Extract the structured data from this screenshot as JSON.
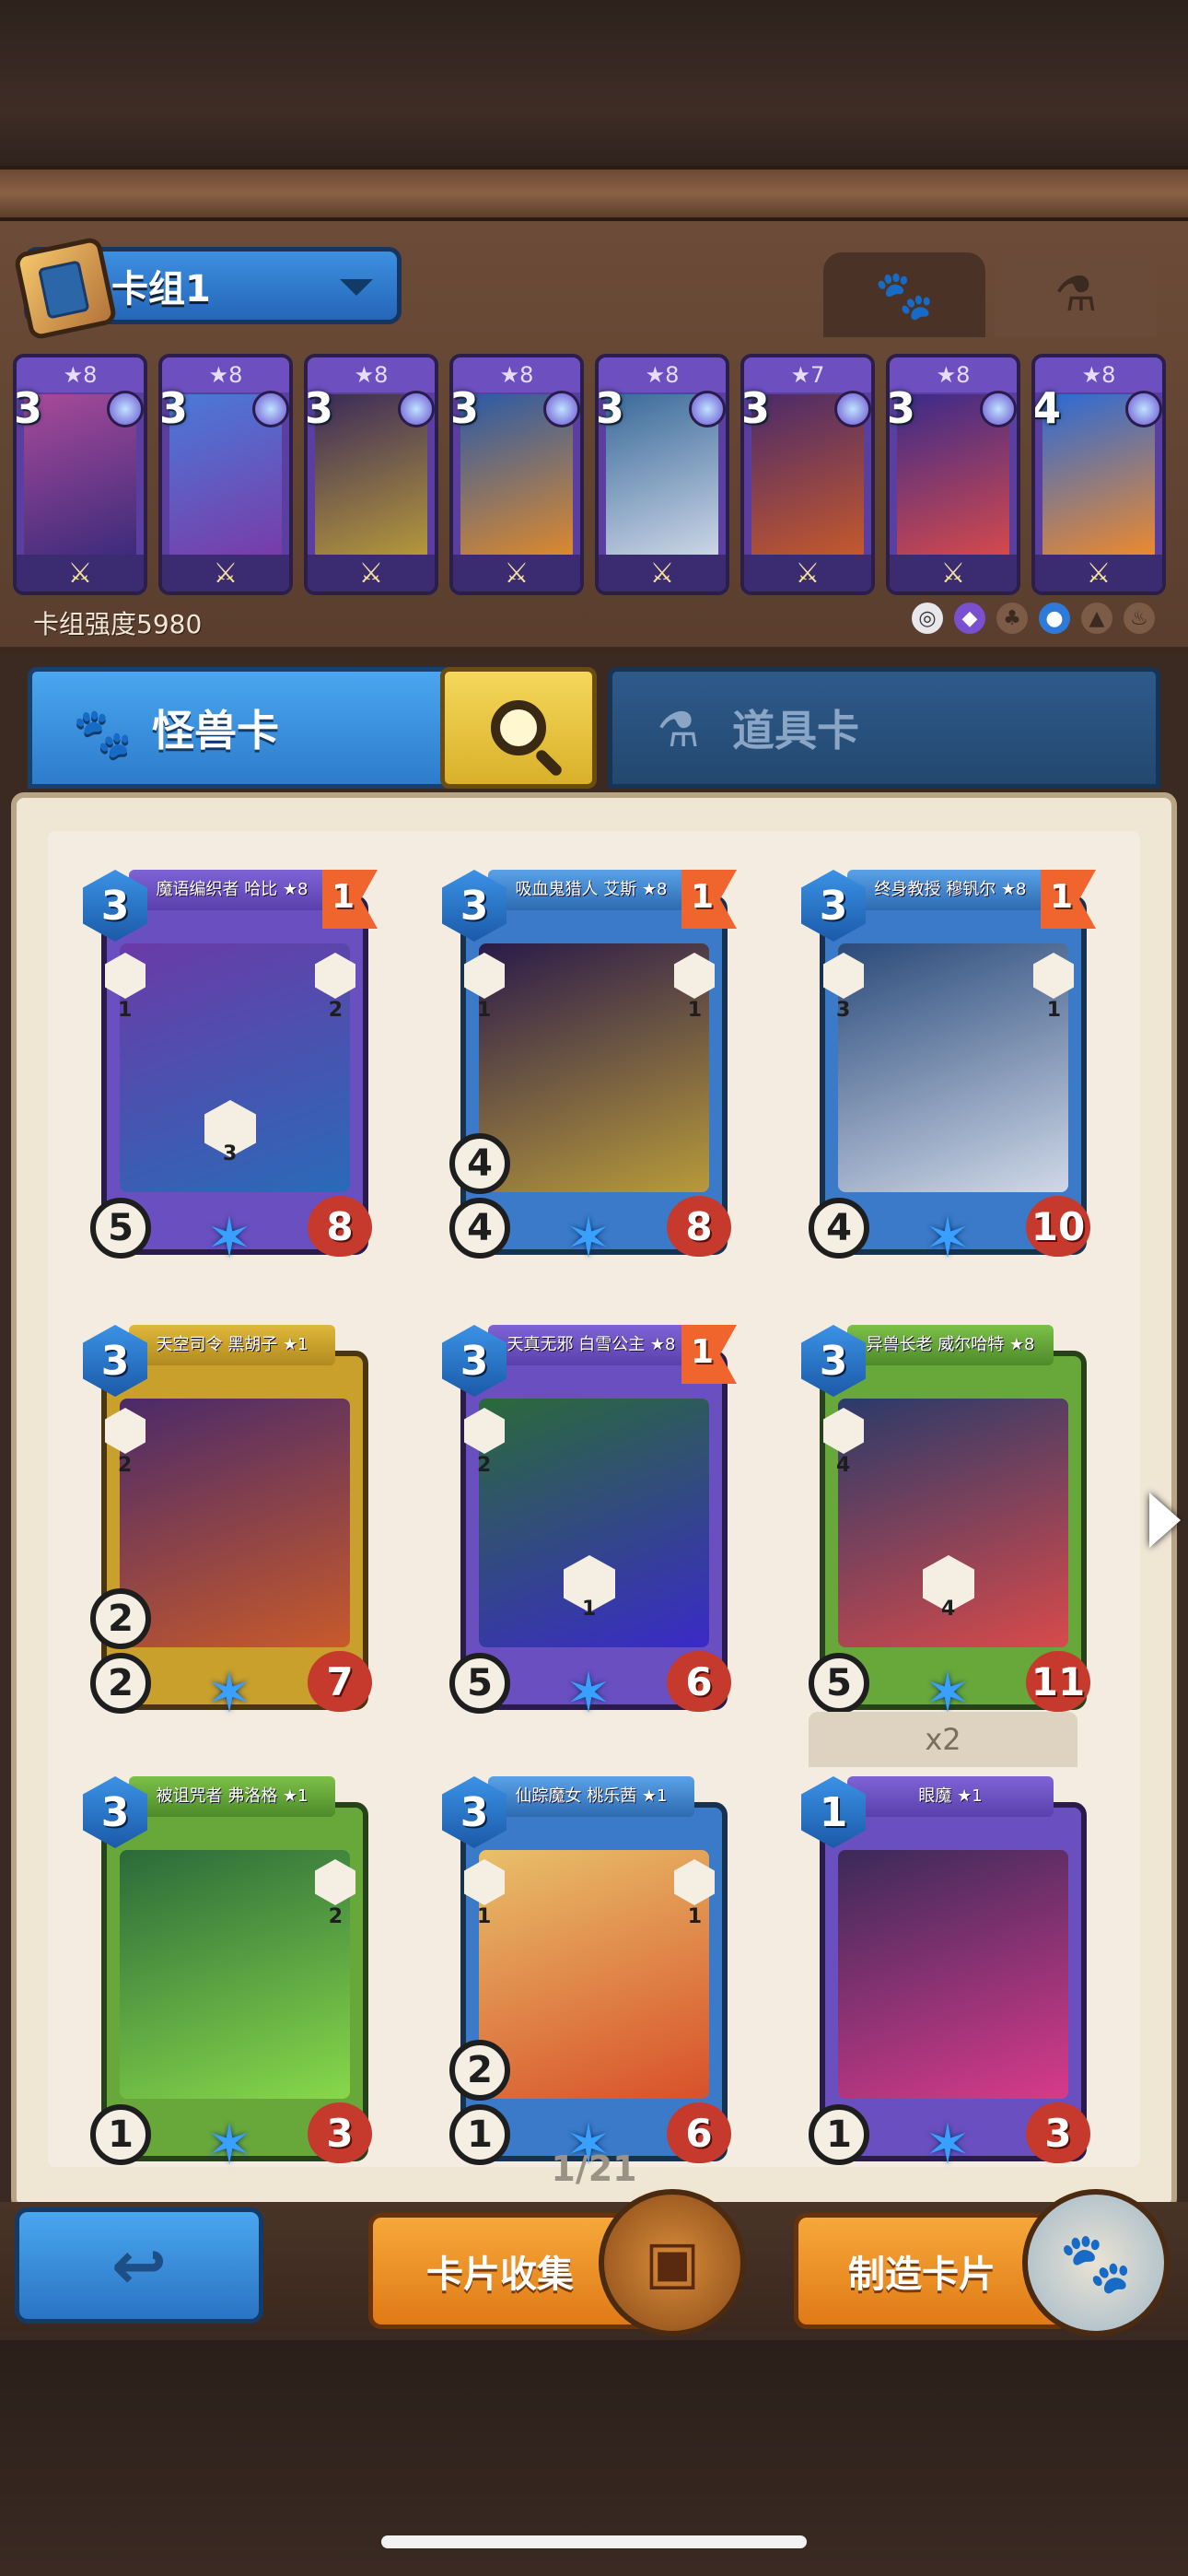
{
  "deck": {
    "name": "卡组1",
    "strength_label": "卡组强度5980",
    "cards": [
      {
        "cost": "3",
        "stars": "★8",
        "art_colors": [
          "#a84a9a",
          "#3a2a7a"
        ],
        "type_icon": "sword"
      },
      {
        "cost": "3",
        "stars": "★8",
        "art_colors": [
          "#4a7ad8",
          "#7a3aa8"
        ],
        "type_icon": "staff"
      },
      {
        "cost": "3",
        "stars": "★8",
        "art_colors": [
          "#3a2a5a",
          "#b89a3a"
        ],
        "type_icon": "sword-staff"
      },
      {
        "cost": "3",
        "stars": "★8",
        "art_colors": [
          "#2a5aa8",
          "#e08a2a"
        ],
        "type_icon": "staff"
      },
      {
        "cost": "3",
        "stars": "★8",
        "art_colors": [
          "#3a6a9a",
          "#cfd8e8"
        ],
        "type_icon": "staff"
      },
      {
        "cost": "3",
        "stars": "★7",
        "art_colors": [
          "#4a2a6a",
          "#c85a2a"
        ],
        "type_icon": "dice-staff"
      },
      {
        "cost": "3",
        "stars": "★8",
        "art_colors": [
          "#3a2a8a",
          "#d84a4a"
        ],
        "type_icon": "dice"
      },
      {
        "cost": "4",
        "stars": "★8",
        "art_colors": [
          "#2a6ad8",
          "#f08a2a"
        ],
        "type_icon": "sword"
      }
    ]
  },
  "tabs": {
    "monster": "怪兽卡",
    "item": "道具卡"
  },
  "collection": [
    {
      "title": "魔语编织者 哈比 ★8",
      "cost": "3",
      "flag": "1",
      "atk": "5",
      "hp": "8",
      "color": "purple",
      "art": [
        "#6a3aa8",
        "#2a6ab8"
      ],
      "skill_num": "3",
      "side_left": "1",
      "side_right": "2"
    },
    {
      "title": "吸血鬼猎人 艾斯 ★8",
      "cost": "3",
      "flag": "1",
      "atk": "4",
      "atk2": "4",
      "hp": "8",
      "color": "blue",
      "art": [
        "#2a1a4a",
        "#b89a3a"
      ],
      "side_left": "1",
      "side_right": "1"
    },
    {
      "title": "终身教授 穆钒尔 ★8",
      "cost": "3",
      "flag": "1",
      "atk": "4",
      "hp": "10",
      "color": "blue",
      "art": [
        "#2a4a7a",
        "#cfd8e8"
      ],
      "side_left": "3",
      "side_right": "1"
    },
    {
      "title": "天空司令 黑胡子 ★1",
      "cost": "3",
      "atk": "2",
      "atk2": "2",
      "hp": "7",
      "color": "yellow",
      "art": [
        "#4a2a6a",
        "#c85a2a"
      ],
      "side_left": "2"
    },
    {
      "title": "天真无邪 白雪公主 ★8",
      "cost": "3",
      "flag": "1",
      "atk": "5",
      "hp": "6",
      "color": "purple",
      "art": [
        "#2a6a3a",
        "#3a2ac8"
      ],
      "skill_num": "1",
      "side_left": "2"
    },
    {
      "title": "异兽长老 威尔哈特 ★8",
      "cost": "3",
      "atk": "5",
      "hp": "11",
      "color": "green",
      "art": [
        "#2a3a6a",
        "#d84a4a"
      ],
      "skill_num": "4",
      "side_left": "4"
    },
    {
      "title": "被诅咒者 弗洛格 ★1",
      "cost": "3",
      "atk": "1",
      "hp": "3",
      "color": "green",
      "art": [
        "#2a6a3a",
        "#88d84a"
      ],
      "side_right": "2"
    },
    {
      "title": "仙踪魔女 桃乐茜 ★1",
      "cost": "3",
      "atk": "1",
      "atk2": "2",
      "hp": "6",
      "color": "blue",
      "art": [
        "#e8c06a",
        "#d8502a"
      ],
      "side_left": "1",
      "side_right": "1"
    },
    {
      "title": "眼魔 ★1",
      "cost": "1",
      "atk": "1",
      "hp": "3",
      "color": "purple",
      "art": [
        "#3a2a5a",
        "#d83a8a"
      ]
    }
  ],
  "duplicate_badge": "x2",
  "pager": "1/21",
  "buttons": {
    "collect": "卡片收集",
    "craft": "制造卡片"
  },
  "colors": {
    "accent_blue": "#3a8fe0",
    "accent_orange": "#f0902a",
    "hp_red": "#c63a2e"
  }
}
